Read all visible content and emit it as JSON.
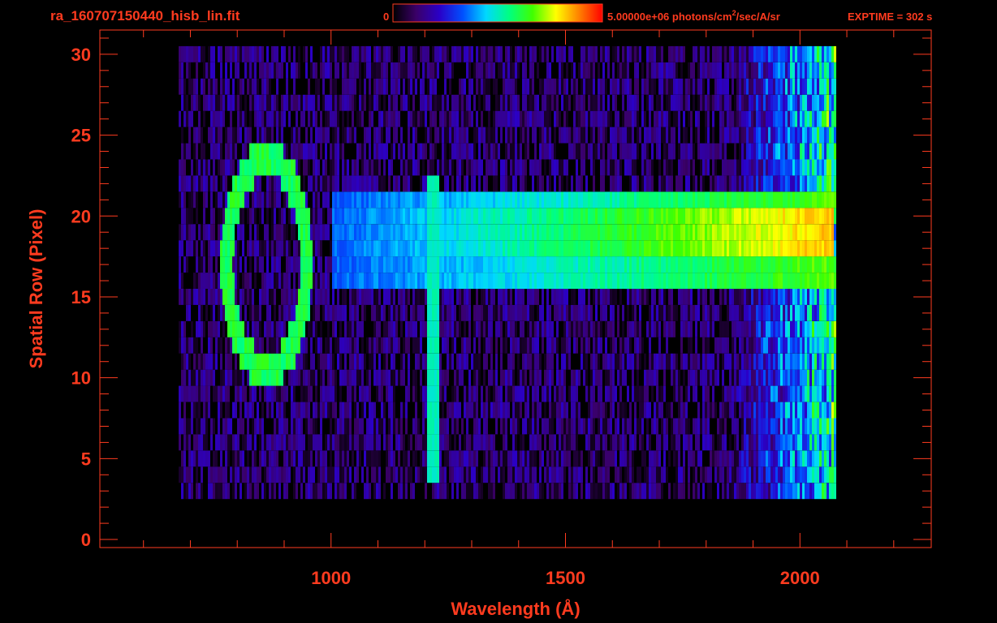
{
  "chart_data": {
    "type": "heatmap",
    "title": "ra_160707150440_hisb_lin.fit",
    "colorbar": {
      "min_label": "0",
      "max_label": "5.00000e+06 photons/cm",
      "max_label_sup": "2",
      "max_label_tail": "/sec/A/sr",
      "colors": [
        "#000000",
        "#3a0068",
        "#2a00c8",
        "#0050ff",
        "#00d8ff",
        "#00ff80",
        "#40ff00",
        "#ffff00",
        "#ff8000",
        "#ff0000"
      ]
    },
    "exptime_label": "EXPTIME = 302 s",
    "xlabel": "Wavelength (Å)",
    "ylabel": "Spatial Row (Pixel)",
    "xlim": [
      507,
      2280
    ],
    "ylim": [
      -0.5,
      31.5
    ],
    "xticks": [
      {
        "value": 1000,
        "label": "1000"
      },
      {
        "value": 1500,
        "label": "1500"
      },
      {
        "value": 2000,
        "label": "2000"
      }
    ],
    "yticks": [
      {
        "value": 0,
        "label": "0"
      },
      {
        "value": 5,
        "label": "5"
      },
      {
        "value": 10,
        "label": "10"
      },
      {
        "value": 15,
        "label": "15"
      },
      {
        "value": 20,
        "label": "20"
      },
      {
        "value": 25,
        "label": "25"
      },
      {
        "value": 30,
        "label": "30"
      }
    ],
    "x_minor_step": 100,
    "y_minor_step": 1,
    "data_extent": {
      "x_min": 675,
      "x_max": 2075,
      "row_min": 3,
      "row_max": 30
    },
    "features": [
      {
        "name": "Ly-alpha",
        "x": 1216,
        "rows": [
          4,
          22
        ],
        "intensity": 0.48
      },
      {
        "name": "spectrum",
        "x_from": 1000,
        "x_to": 2070,
        "rows": [
          16,
          21
        ],
        "intensity": 0.8
      }
    ]
  }
}
